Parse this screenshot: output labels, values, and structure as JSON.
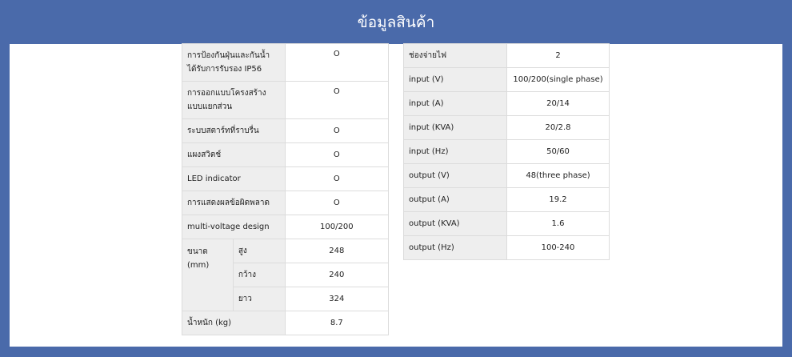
{
  "header": {
    "title": "ข้อมูลสินค้า"
  },
  "left_table": {
    "rows": [
      {
        "label": "การป้องกันฝุ่นและกันน้ำ ได้รับการรับรอง IP56",
        "value": "O"
      },
      {
        "label": "การออกแบบโครงสร้างแบบแยกส่วน",
        "value": "O"
      },
      {
        "label": "ระบบสตาร์ทที่ราบรื่น",
        "value": "O"
      },
      {
        "label": "แผงสวิตช์",
        "value": "O"
      },
      {
        "label": "LED indicator",
        "value": "O"
      },
      {
        "label": "การแสดงผลข้อผิดพลาด",
        "value": "O"
      },
      {
        "label": "multi-voltage design",
        "value": "100/200"
      }
    ],
    "size_group": {
      "label": "ขนาด (mm)",
      "rows": [
        {
          "label": "สูง",
          "value": "248"
        },
        {
          "label": "กว้าง",
          "value": "240"
        },
        {
          "label": "ยาว",
          "value": "324"
        }
      ]
    },
    "weight": {
      "label": "น้ำหนัก (kg)",
      "value": "8.7"
    }
  },
  "right_table": {
    "rows": [
      {
        "label": "ช่องจ่ายไฟ",
        "value": "2"
      },
      {
        "label": "input (V)",
        "value": "100/200(single phase)"
      },
      {
        "label": "input (A)",
        "value": "20/14"
      },
      {
        "label": "input (KVA)",
        "value": "20/2.8"
      },
      {
        "label": "input (Hz)",
        "value": "50/60"
      },
      {
        "label": "output (V)",
        "value": "48(three phase)"
      },
      {
        "label": "output (A)",
        "value": "19.2"
      },
      {
        "label": "output (KVA)",
        "value": "1.6"
      },
      {
        "label": "output (Hz)",
        "value": "100-240"
      }
    ]
  }
}
